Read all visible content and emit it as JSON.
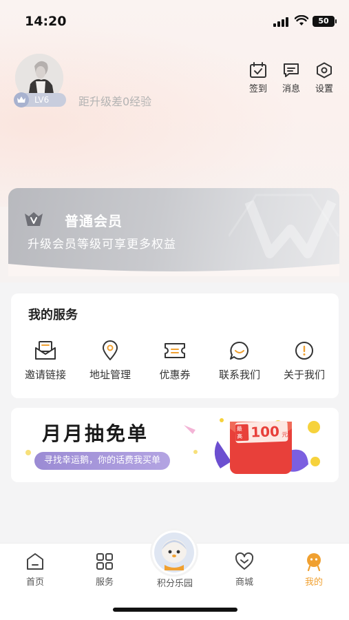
{
  "status_bar": {
    "time": "14:20",
    "battery": "50"
  },
  "profile": {
    "level": "LV6",
    "exp_text": "距升级差0经验"
  },
  "top_actions": [
    {
      "label": "签到",
      "icon": "calendar-check-icon"
    },
    {
      "label": "消息",
      "icon": "message-icon"
    },
    {
      "label": "设置",
      "icon": "settings-hex-icon"
    }
  ],
  "membership": {
    "title": "普通会员",
    "subtitle": "升级会员等级可享更多权益"
  },
  "services": {
    "heading": "我的服务",
    "items": [
      {
        "label": "邀请链接",
        "icon": "envelope-icon"
      },
      {
        "label": "地址管理",
        "icon": "location-pin-icon"
      },
      {
        "label": "优惠券",
        "icon": "coupon-icon"
      },
      {
        "label": "联系我们",
        "icon": "chat-smile-icon"
      },
      {
        "label": "关于我们",
        "icon": "info-exclamation-icon"
      }
    ]
  },
  "banner": {
    "title": "月月抽免单",
    "subtitle": "寻找幸运鹅，你的话费我买单",
    "envelope_tag": "最高",
    "envelope_amount": "100",
    "envelope_unit": "元"
  },
  "bottom_nav": {
    "items": [
      {
        "label": "首页",
        "icon": "home-icon"
      },
      {
        "label": "服务",
        "icon": "grid-icon"
      },
      {
        "label": "积分乐园",
        "icon": "mascot-icon"
      },
      {
        "label": "商城",
        "icon": "heart-shop-icon"
      },
      {
        "label": "我的",
        "icon": "profile-mascot-icon"
      }
    ],
    "active": "我的"
  },
  "colors": {
    "accent_orange": "#f0a030",
    "icon_dark": "#333333",
    "pill_purple": "#a596dc",
    "envelope_red": "#e8403a"
  }
}
